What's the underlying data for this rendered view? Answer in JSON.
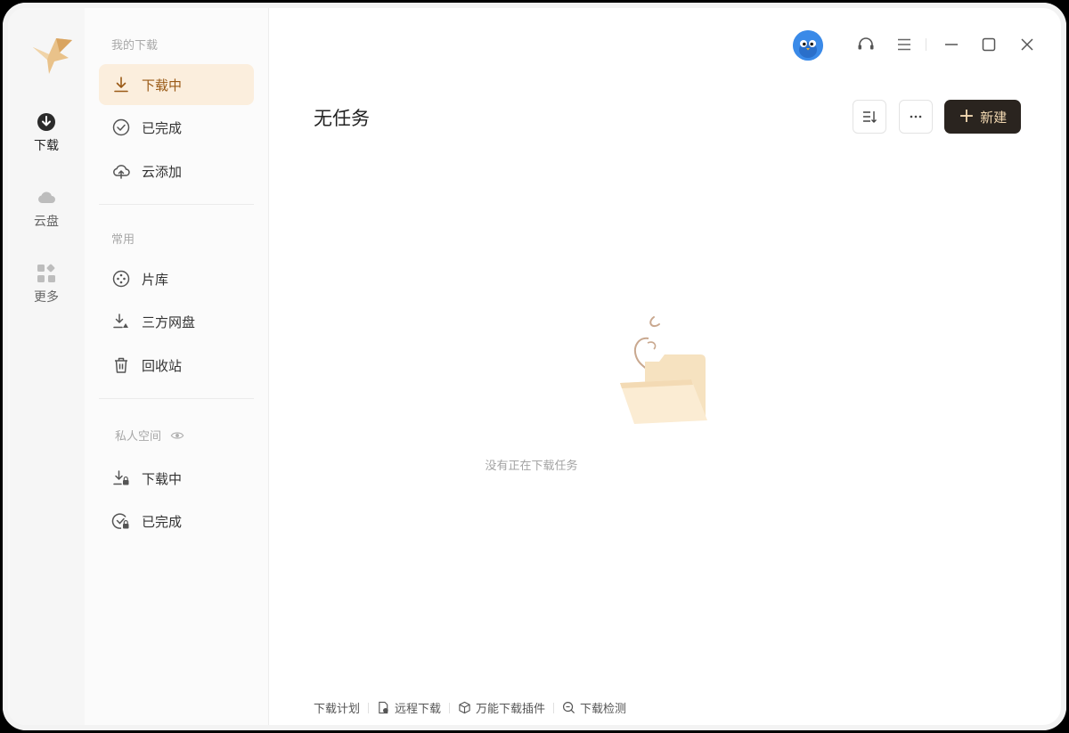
{
  "rail": {
    "items": [
      {
        "label": "下载",
        "icon": "download-circle-icon",
        "active": true
      },
      {
        "label": "云盘",
        "icon": "cloud-icon",
        "active": false
      },
      {
        "label": "更多",
        "icon": "apps-grid-icon",
        "active": false
      }
    ]
  },
  "sidebar": {
    "section_my_downloads": "我的下载",
    "downloading": "下载中",
    "completed": "已完成",
    "cloud_add": "云添加",
    "section_common": "常用",
    "library": "片库",
    "third_party_drive": "三方网盘",
    "recycle_bin": "回收站",
    "section_private": "私人空间",
    "private_downloading": "下载中",
    "private_completed": "已完成"
  },
  "main": {
    "title": "无任务",
    "new_button": "新建",
    "empty_message": "没有正在下载任务"
  },
  "footer": {
    "plan": "下载计划",
    "remote": "远程下载",
    "plugin": "万能下载插件",
    "check": "下载检测"
  },
  "colors": {
    "accent": "#9a5a16",
    "active_bg": "#fbeedd",
    "new_button_bg": "#2a241f",
    "new_button_text": "#f3d9b2"
  }
}
